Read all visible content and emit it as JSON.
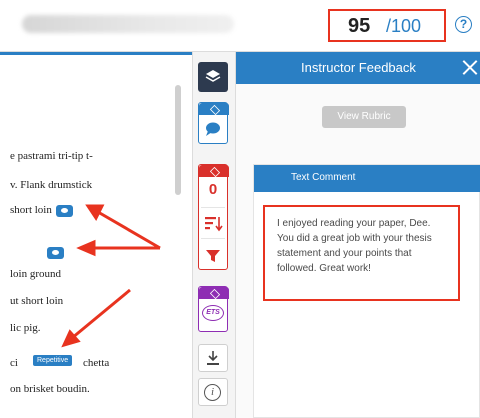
{
  "header": {
    "score": "95",
    "score_max": "/100",
    "help_glyph": "?"
  },
  "document": {
    "lines": [
      "e pastrami tri-tip t-",
      "v. Flank drumstick",
      "short loin",
      "loin ground",
      "ut short loin",
      "lic pig.",
      "ci",
      "chetta",
      "on brisket boudin."
    ],
    "tag_label": "Repetitive"
  },
  "rail": {
    "count_value": "0",
    "ets_label": "ETS",
    "info_glyph": "i"
  },
  "panel": {
    "title": "Instructor Feedback",
    "view_rubric": "View Rubric",
    "comment_title": "Text Comment",
    "comment_text": "I enjoyed reading your paper, Dee. You did a great job with your thesis statement and your points that followed. Great work!"
  },
  "colors": {
    "accent": "#2a7fc4",
    "annotation": "#e8331f",
    "dark_tool": "#2d3a4f",
    "red_tool": "#d9302b",
    "purple_tool": "#8e2db3"
  },
  "icons": [
    "layers-icon",
    "comment-icon",
    "sort-icon",
    "filter-icon",
    "ets-icon",
    "download-icon",
    "info-icon",
    "help-icon",
    "close-icon"
  ]
}
